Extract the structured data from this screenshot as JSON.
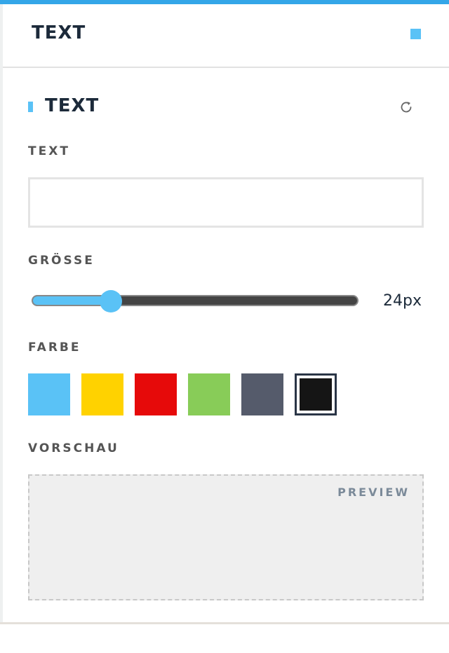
{
  "header": {
    "title": "TEXT"
  },
  "section": {
    "title": "TEXT"
  },
  "text_field": {
    "label": "TEXT",
    "value": "",
    "placeholder": ""
  },
  "size": {
    "label": "GRÖSSE",
    "value_text": "24px",
    "fraction": 0.24
  },
  "color": {
    "label": "FARBE",
    "swatches": [
      "#5ac2f6",
      "#ffd200",
      "#e60a0a",
      "#88cc58",
      "#555b6b",
      "#151515"
    ],
    "selected_index": 5
  },
  "preview": {
    "label": "VORSCHAU",
    "badge": "PREVIEW"
  },
  "icons": {
    "reset": "refresh-icon"
  }
}
